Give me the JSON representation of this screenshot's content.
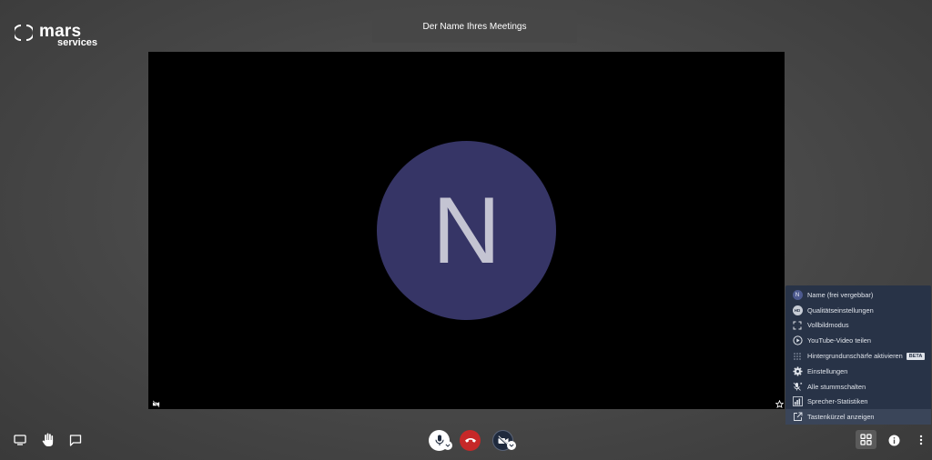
{
  "logo": {
    "brand": "mars",
    "sub": "services"
  },
  "meeting": {
    "title": "Der Name Ihres Meetings"
  },
  "participant": {
    "initial": "N"
  },
  "more_menu": {
    "items": [
      {
        "label": "Name (frei vergebbar)",
        "icon": "avatar-icon",
        "avatar": "N"
      },
      {
        "label": "Qualitätseinstellungen",
        "icon": "hd-icon",
        "badge_icon_text": "HD"
      },
      {
        "label": "Vollbildmodus",
        "icon": "fullscreen-icon"
      },
      {
        "label": "YouTube-Video teilen",
        "icon": "play-circle-icon"
      },
      {
        "label": "Hintergrundunschärfe aktivieren",
        "icon": "blur-icon",
        "badge": "BETA"
      },
      {
        "label": "Einstellungen",
        "icon": "gear-icon"
      },
      {
        "label": "Alle stummschalten",
        "icon": "mute-all-icon"
      },
      {
        "label": "Sprecher-Statistiken",
        "icon": "stats-icon"
      },
      {
        "label": "Tastenkürzel anzeigen",
        "icon": "external-link-icon"
      }
    ]
  },
  "toolbar": {
    "left": [
      "screen-share-icon",
      "raise-hand-icon",
      "chat-icon"
    ],
    "center": [
      "microphone-icon",
      "hangup-icon",
      "camera-off-icon"
    ],
    "right": [
      "tile-view-icon",
      "info-icon",
      "more-vert-icon"
    ]
  },
  "colors": {
    "avatar": "#363566",
    "menu_bg": "#283347",
    "hangup": "#c62828",
    "stage": "#000000"
  }
}
